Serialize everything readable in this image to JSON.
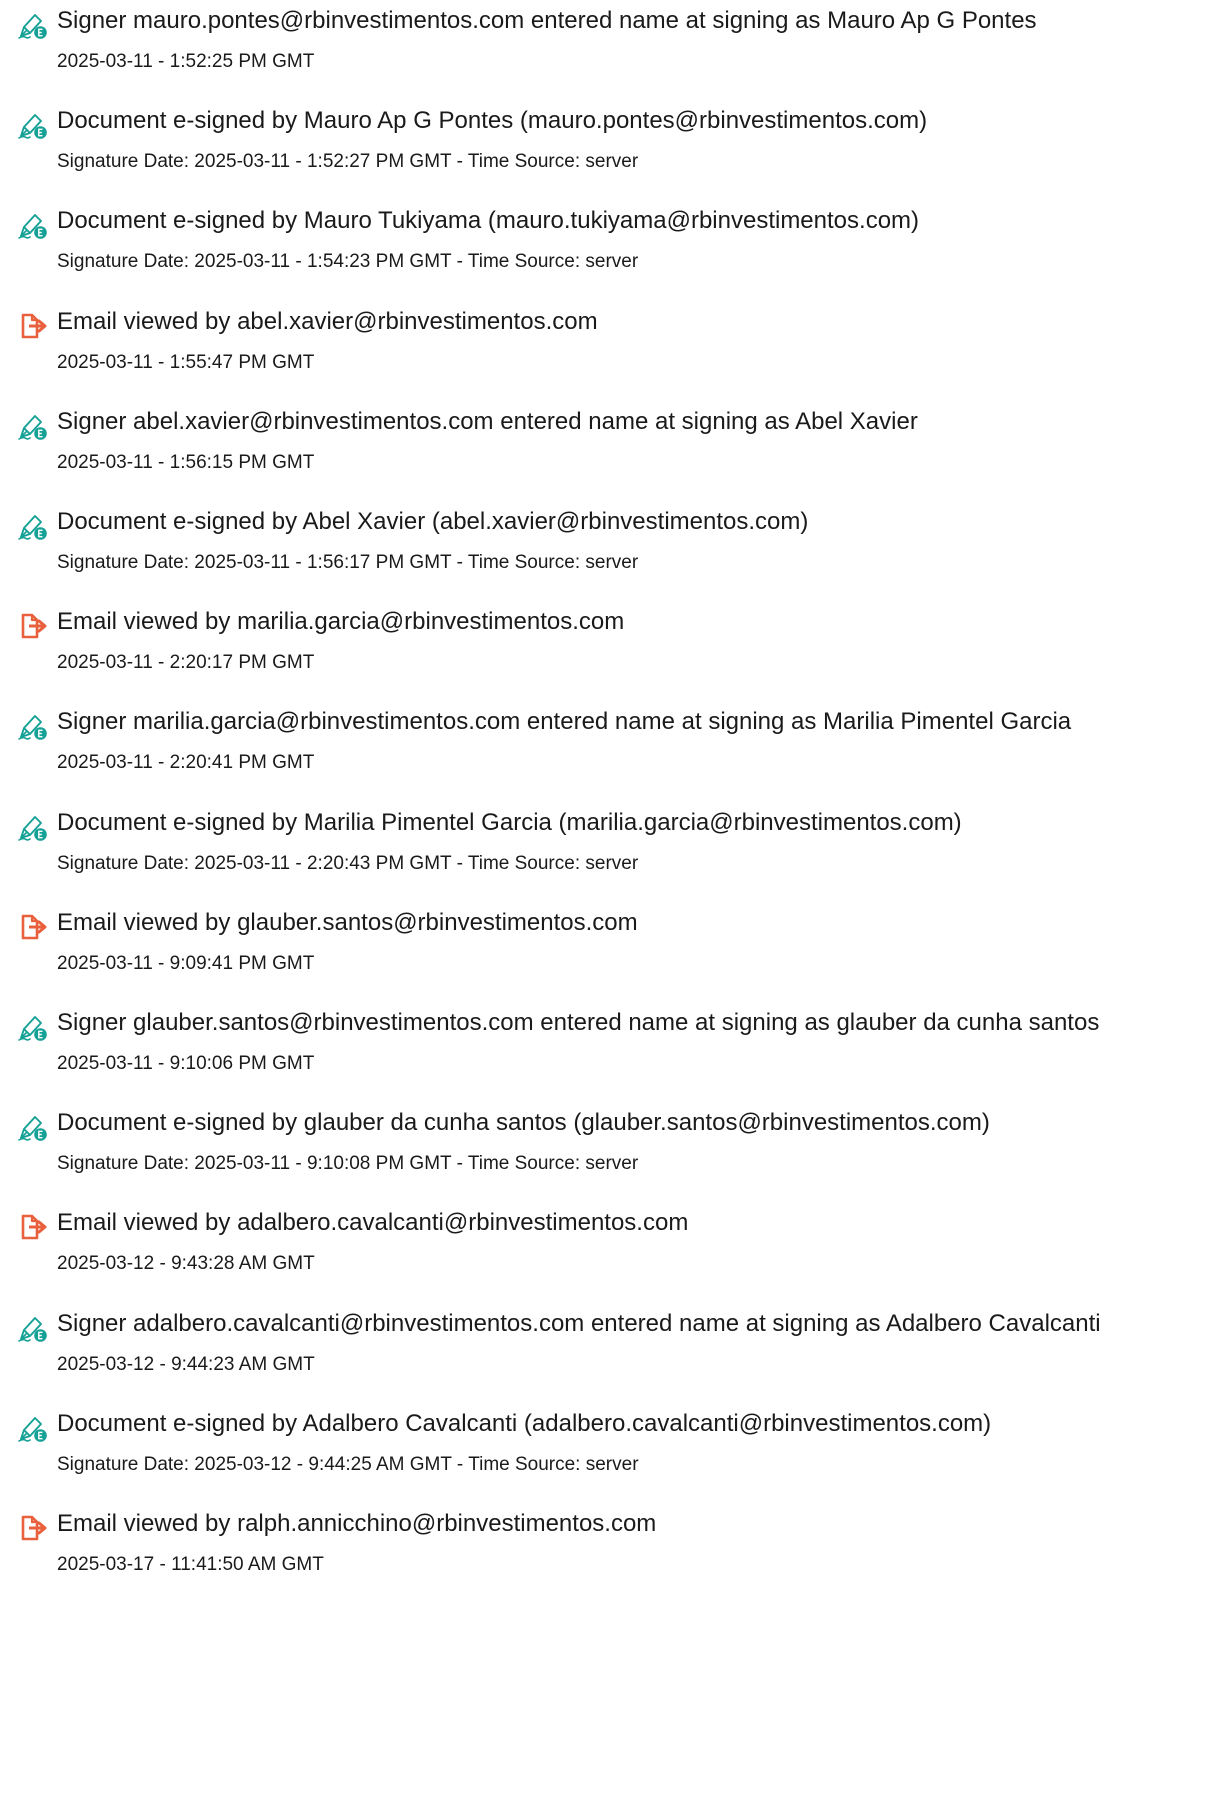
{
  "entries": [
    {
      "type": "sign",
      "icon": "signature-pen-icon",
      "text": "Signer mauro.pontes@rbinvestimentos.com entered name at signing as Mauro Ap G Pontes",
      "detail": "2025-03-11 - 1:52:25 PM GMT"
    },
    {
      "type": "sign",
      "icon": "signature-pen-icon",
      "text": "Document e-signed by Mauro Ap G Pontes (mauro.pontes@rbinvestimentos.com)",
      "detail": "Signature Date: 2025-03-11 - 1:52:27 PM GMT - Time Source: server"
    },
    {
      "type": "sign",
      "icon": "signature-pen-icon",
      "text": "Document e-signed by Mauro Tukiyama (mauro.tukiyama@rbinvestimentos.com)",
      "detail": "Signature Date: 2025-03-11 - 1:54:23 PM GMT - Time Source: server"
    },
    {
      "type": "view",
      "icon": "document-viewed-icon",
      "text": "Email viewed by abel.xavier@rbinvestimentos.com",
      "detail": "2025-03-11 - 1:55:47 PM GMT"
    },
    {
      "type": "sign",
      "icon": "signature-pen-icon",
      "text": "Signer abel.xavier@rbinvestimentos.com entered name at signing as Abel Xavier",
      "detail": "2025-03-11 - 1:56:15 PM GMT"
    },
    {
      "type": "sign",
      "icon": "signature-pen-icon",
      "text": "Document e-signed by Abel Xavier (abel.xavier@rbinvestimentos.com)",
      "detail": "Signature Date: 2025-03-11 - 1:56:17 PM GMT - Time Source: server"
    },
    {
      "type": "view",
      "icon": "document-viewed-icon",
      "text": "Email viewed by marilia.garcia@rbinvestimentos.com",
      "detail": "2025-03-11 - 2:20:17 PM GMT"
    },
    {
      "type": "sign",
      "icon": "signature-pen-icon",
      "text": "Signer marilia.garcia@rbinvestimentos.com entered name at signing as Marilia Pimentel Garcia",
      "detail": "2025-03-11 - 2:20:41 PM GMT"
    },
    {
      "type": "sign",
      "icon": "signature-pen-icon",
      "text": "Document e-signed by Marilia Pimentel Garcia (marilia.garcia@rbinvestimentos.com)",
      "detail": "Signature Date: 2025-03-11 - 2:20:43 PM GMT - Time Source: server"
    },
    {
      "type": "view",
      "icon": "document-viewed-icon",
      "text": "Email viewed by glauber.santos@rbinvestimentos.com",
      "detail": "2025-03-11 - 9:09:41 PM GMT"
    },
    {
      "type": "sign",
      "icon": "signature-pen-icon",
      "text": "Signer glauber.santos@rbinvestimentos.com entered name at signing as glauber da cunha santos",
      "detail": "2025-03-11 - 9:10:06 PM GMT"
    },
    {
      "type": "sign",
      "icon": "signature-pen-icon",
      "text": "Document e-signed by glauber da cunha santos (glauber.santos@rbinvestimentos.com)",
      "detail": "Signature Date: 2025-03-11 - 9:10:08 PM GMT - Time Source: server"
    },
    {
      "type": "view",
      "icon": "document-viewed-icon",
      "text": "Email viewed by adalbero.cavalcanti@rbinvestimentos.com",
      "detail": "2025-03-12 - 9:43:28 AM GMT"
    },
    {
      "type": "sign",
      "icon": "signature-pen-icon",
      "text": "Signer adalbero.cavalcanti@rbinvestimentos.com entered name at signing as Adalbero Cavalcanti",
      "detail": "2025-03-12 - 9:44:23 AM GMT"
    },
    {
      "type": "sign",
      "icon": "signature-pen-icon",
      "text": "Document e-signed by Adalbero Cavalcanti (adalbero.cavalcanti@rbinvestimentos.com)",
      "detail": "Signature Date: 2025-03-12 - 9:44:25 AM GMT - Time Source: server"
    },
    {
      "type": "view",
      "icon": "document-viewed-icon",
      "text": "Email viewed by ralph.annicchino@rbinvestimentos.com",
      "detail": "2025-03-17 - 11:41:50 AM GMT"
    }
  ],
  "colors": {
    "sign_icon": "#15a196",
    "view_icon": "#e8603c",
    "text": "#1a1a1a"
  }
}
